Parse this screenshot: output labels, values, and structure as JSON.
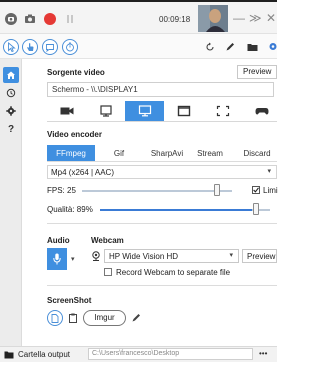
{
  "titlebar": {
    "timer": "00:09:18",
    "minimize": "—",
    "collapse": "≫",
    "close": "✕",
    "icons": [
      "camera-icon",
      "screenshot-icon",
      "record-icon",
      "pause-icon"
    ]
  },
  "toolbar": {
    "mode_icons": [
      "cursor-icon",
      "click-icon",
      "keystroke-icon",
      "timer-icon"
    ],
    "right_icons": [
      "refresh-icon",
      "pen-icon",
      "folder-icon",
      "gear-icon"
    ]
  },
  "sidebar": {
    "items": [
      "home-icon",
      "history-icon",
      "settings-icon",
      "help-icon"
    ],
    "help_label": "?"
  },
  "video_source": {
    "title": "Sorgente video",
    "preview_label": "Preview",
    "value": "Schermo - \\\\.\\DISPLAY1",
    "selected_index": 2
  },
  "encoder": {
    "title": "Video encoder",
    "tabs": [
      "FFmpeg",
      "Gif",
      "SharpAvi",
      "Stream",
      "Discard"
    ],
    "selected_tab": "FFmpeg",
    "codec": "Mp4 (x264 | AAC)",
    "fps_label": "FPS: 25",
    "fps_value": 25,
    "limit_label": "Limi",
    "quality_label": "Qualità:  89%",
    "quality_percent": 89
  },
  "audio": {
    "title": "Audio"
  },
  "webcam": {
    "title": "Webcam",
    "device": "HP Wide Vision HD",
    "preview_label": "Preview",
    "separate_label": "Record Webcam to separate file"
  },
  "screenshot": {
    "title": "ScreenShot",
    "imgur_label": "Imgur"
  },
  "output": {
    "label": "Cartella output",
    "path": "C:\\Users\\francesco\\Desktop",
    "more": "•••"
  },
  "colors": {
    "accent": "#3a7bd5",
    "record": "#e53935",
    "selected_tab_bg": "#3f8fe0"
  }
}
